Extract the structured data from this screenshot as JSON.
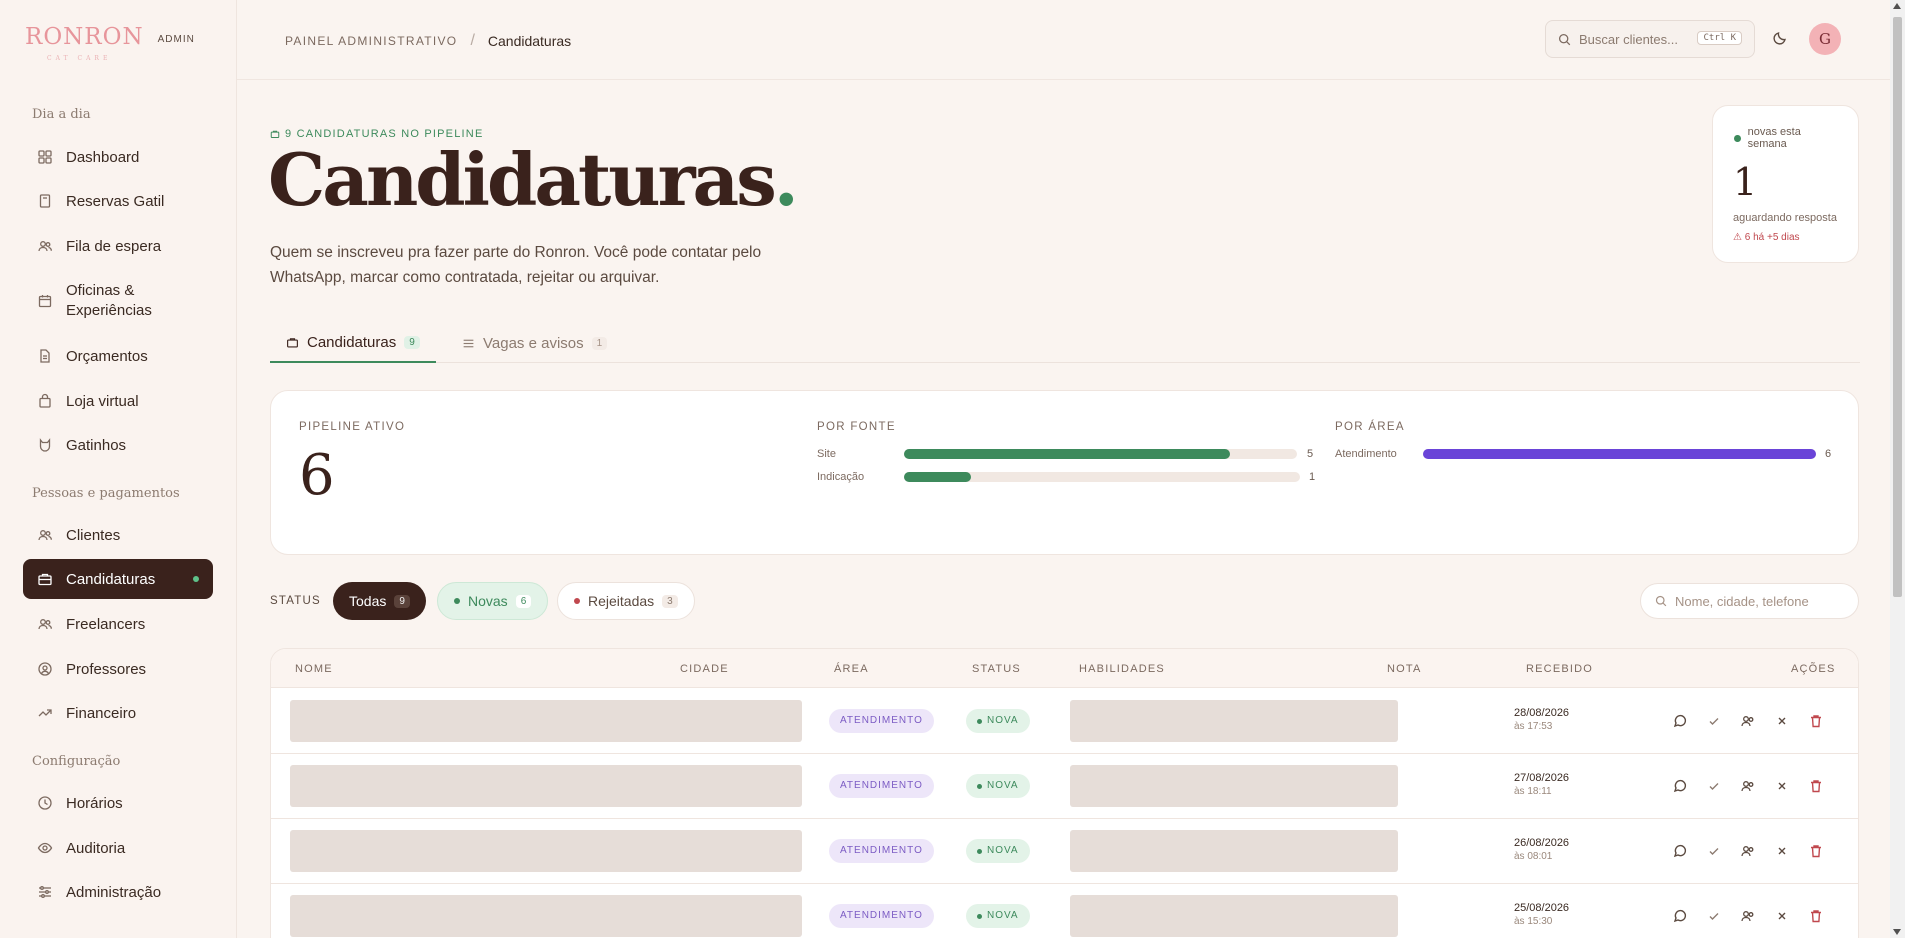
{
  "brand": {
    "logo": "RONRON",
    "sub": "CAT CARE",
    "admin": "ADMIN"
  },
  "sidebar": {
    "sections": [
      "Dia a dia",
      "Pessoas e pagamentos",
      "Configuração"
    ],
    "items": [
      {
        "label": "Dashboard",
        "icon": "grid-icon"
      },
      {
        "label": "Reservas Gatil",
        "icon": "book-icon"
      },
      {
        "label": "Fila de espera",
        "icon": "users-icon"
      },
      {
        "label": "Oficinas & Experiências",
        "icon": "calendar-icon"
      },
      {
        "label": "Orçamentos",
        "icon": "file-icon"
      },
      {
        "label": "Loja virtual",
        "icon": "bag-icon"
      },
      {
        "label": "Gatinhos",
        "icon": "cat-icon"
      },
      {
        "label": "Clientes",
        "icon": "users-icon"
      },
      {
        "label": "Candidaturas",
        "icon": "briefcase-icon"
      },
      {
        "label": "Freelancers",
        "icon": "users-icon"
      },
      {
        "label": "Professores",
        "icon": "badge-icon"
      },
      {
        "label": "Financeiro",
        "icon": "trend-icon"
      },
      {
        "label": "Horários",
        "icon": "clock-icon"
      },
      {
        "label": "Auditoria",
        "icon": "eye-icon"
      },
      {
        "label": "Administração",
        "icon": "sliders-icon"
      }
    ]
  },
  "topbar": {
    "crumb_root": "PAINEL ADMINISTRATIVO",
    "crumb_sep": "/",
    "crumb_current": "Candidaturas",
    "search_placeholder": "Buscar clientes...",
    "search_kbd": "Ctrl K",
    "avatar": "G"
  },
  "hero": {
    "eyebrow": "9 CANDIDATURAS NO PIPELINE",
    "title": "Candidaturas",
    "title_dot": ".",
    "lede": "Quem se inscreveu pra fazer parte do Ronron. Você pode contatar pelo WhatsApp, marcar como contratada, rejeitar ou arquivar."
  },
  "week_card": {
    "label": "novas esta semana",
    "value": "1",
    "sub": "aguardando resposta",
    "alert": "⚠ 6 há +5 dias"
  },
  "tabs": [
    {
      "label": "Candidaturas",
      "count": "9"
    },
    {
      "label": "Vagas e avisos",
      "count": "1"
    }
  ],
  "stats": {
    "pipeline_label": "PIPELINE ATIVO",
    "pipeline_value": "6",
    "source_label": "POR FONTE",
    "sources": [
      {
        "label": "Site",
        "value": 5,
        "fraction": 0.83
      },
      {
        "label": "Indicação",
        "value": 1,
        "fraction": 0.17
      }
    ],
    "area_label": "POR ÁREA",
    "areas": [
      {
        "label": "Atendimento",
        "value": 6,
        "fraction": 1.0
      }
    ],
    "colors": {
      "source": "#3d8a5c",
      "area": "#6a44d8"
    }
  },
  "filters": {
    "label": "STATUS",
    "all": {
      "label": "Todas",
      "count": "9"
    },
    "new": {
      "label": "Novas",
      "count": "6"
    },
    "rejected": {
      "label": "Rejeitadas",
      "count": "3"
    },
    "search_placeholder": "Nome, cidade, telefone"
  },
  "table": {
    "headers": [
      "NOME",
      "CIDADE",
      "ÁREA",
      "STATUS",
      "HABILIDADES",
      "NOTA",
      "RECEBIDO",
      "AÇÕES"
    ],
    "rows": [
      {
        "area": "ATENDIMENTO",
        "status": "NOVA",
        "date": "28/08/2026",
        "time": "às 17:53"
      },
      {
        "area": "ATENDIMENTO",
        "status": "NOVA",
        "date": "27/08/2026",
        "time": "às 18:11"
      },
      {
        "area": "ATENDIMENTO",
        "status": "NOVA",
        "date": "26/08/2026",
        "time": "às 08:01"
      },
      {
        "area": "ATENDIMENTO",
        "status": "NOVA",
        "date": "25/08/2026",
        "time": "às 15:30"
      }
    ]
  }
}
